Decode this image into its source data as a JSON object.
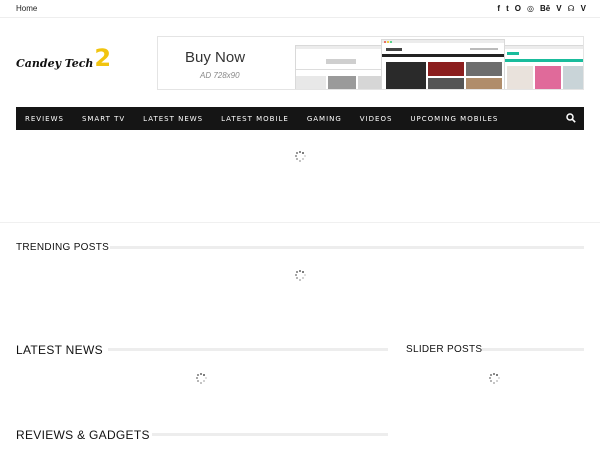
{
  "topbar": {
    "home_label": "Home",
    "social_icons": [
      "facebook-icon",
      "twitter-icon",
      "opera-icon",
      "instagram-icon",
      "behance-icon",
      "vimeo-icon",
      "rss-icon",
      "vimeo-icon"
    ],
    "social_glyphs": [
      "f",
      "t",
      "O",
      "◎",
      "Bē",
      "V",
      "☊",
      "V"
    ]
  },
  "logo": {
    "word": "Candey Tech",
    "number": "2",
    "accent": "#f1c40f"
  },
  "ad": {
    "headline": "Buy Now",
    "size_label": "AD 728x90"
  },
  "nav": {
    "items": [
      "REVIEWS",
      "SMART TV",
      "LATEST NEWS",
      "LATEST MOBILE",
      "GAMING",
      "VIDEOS",
      "UPCOMING MOBILES"
    ],
    "background": "#151515"
  },
  "sections": {
    "trending": "TRENDING POSTS",
    "latest": "LATEST NEWS",
    "slider": "SLIDER POSTS",
    "reviews": "REVIEWS & GADGETS"
  }
}
